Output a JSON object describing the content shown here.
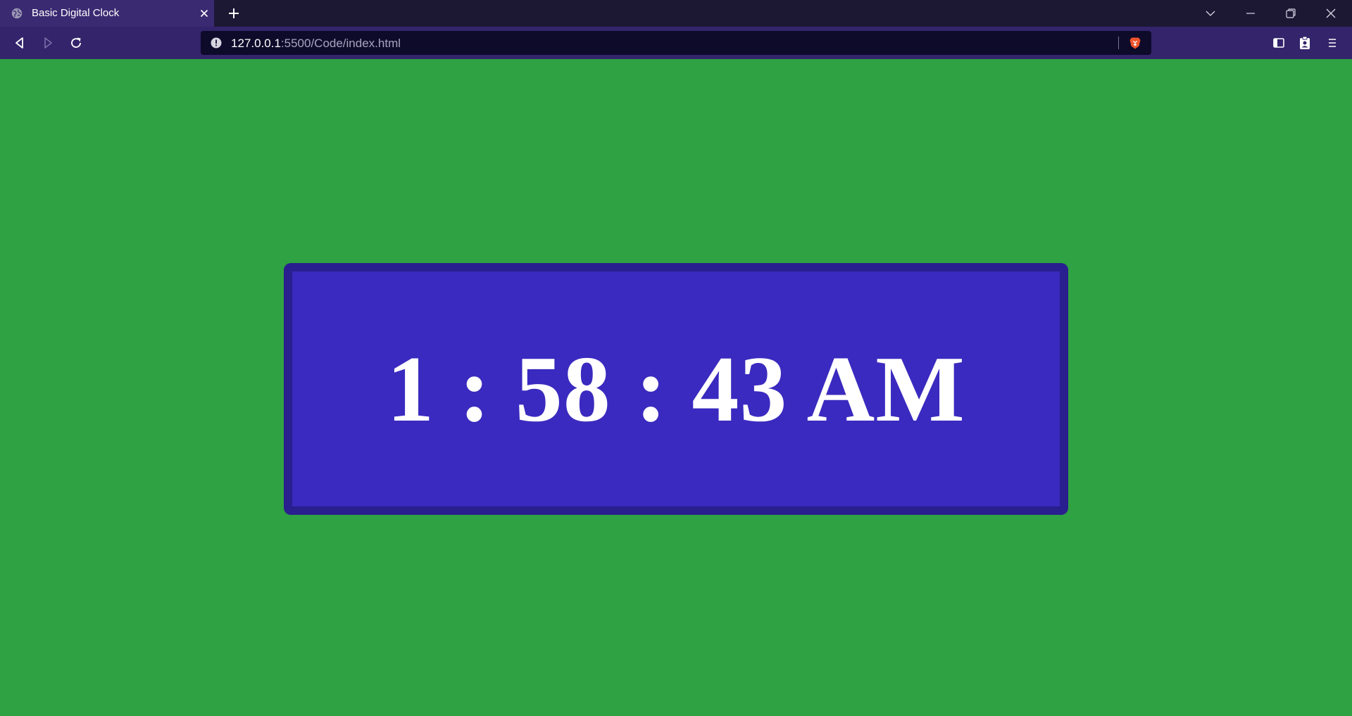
{
  "browser": {
    "tab": {
      "title": "Basic Digital Clock"
    },
    "address_bar": {
      "host": "127.0.0.1",
      "path": ":5500/Code/index.html"
    }
  },
  "page": {
    "clock": {
      "time": "1 : 58 : 43 AM"
    },
    "colors": {
      "background": "#2fa243",
      "clock_border": "#2a1f8e",
      "clock_face": "#3a2abf",
      "clock_text": "#ffffff"
    }
  }
}
